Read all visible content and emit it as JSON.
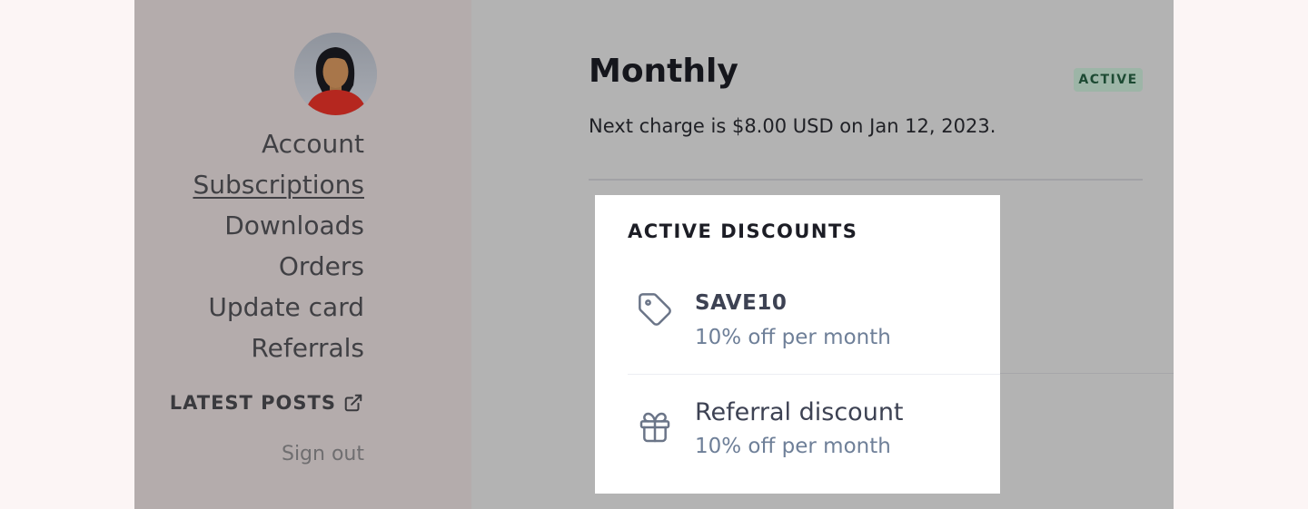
{
  "sidebar": {
    "nav": [
      "Account",
      "Subscriptions",
      "Downloads",
      "Orders",
      "Update card",
      "Referrals"
    ],
    "latest_posts": "LATEST POSTS",
    "sign_out": "Sign out"
  },
  "subscription": {
    "plan": "Monthly",
    "status": "ACTIVE",
    "next_charge": "Next charge is $8.00 USD on Jan 12, 2023."
  },
  "discounts": {
    "title": "ACTIVE DISCOUNTS",
    "items": [
      {
        "name": "SAVE10",
        "description": "10% off per month",
        "icon": "tag-icon"
      },
      {
        "name": "Referral discount",
        "description": "10% off per month",
        "icon": "gift-icon"
      }
    ]
  },
  "colors": {
    "page_background": "#fcf5f5",
    "sidebar_background": "#b4acac",
    "main_background": "#b3b3b3",
    "badge_background": "#9db5a7",
    "badge_text": "#1d4a33",
    "avatar_shirt": "#b5271f"
  }
}
